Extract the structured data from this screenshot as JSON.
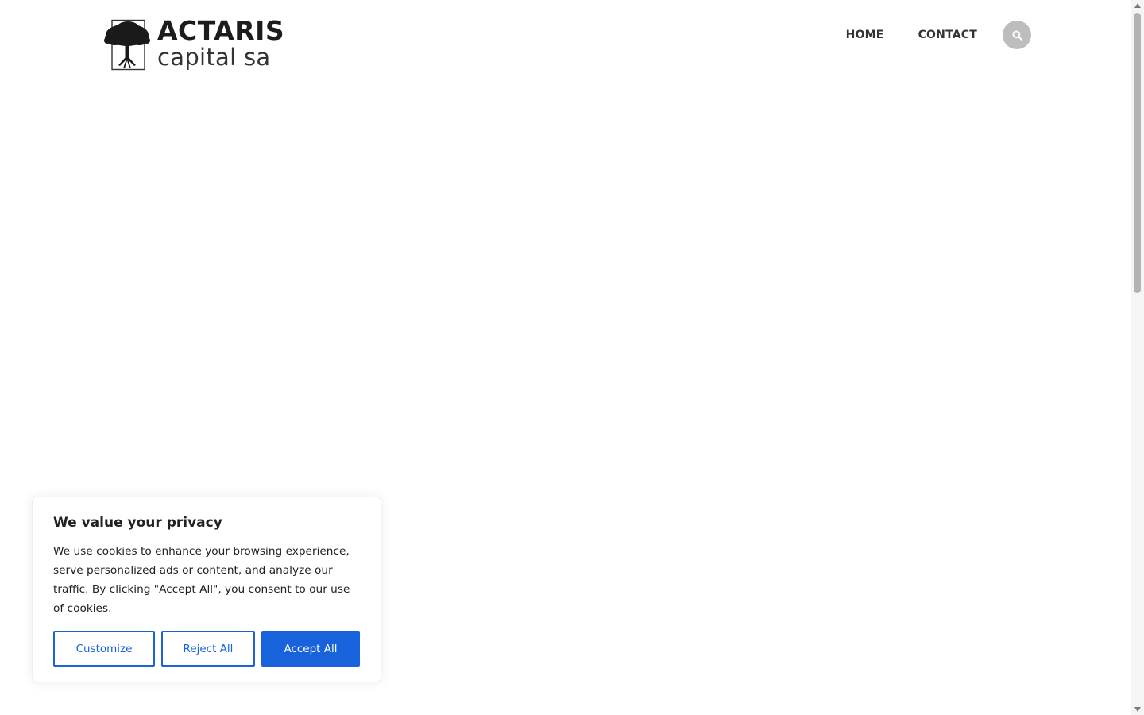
{
  "brand": {
    "name_line1": "ACTARIS",
    "name_line2": "capital sa"
  },
  "nav": {
    "items": [
      {
        "label": "HOME"
      },
      {
        "label": "CONTACT"
      }
    ],
    "search_icon": "search-icon"
  },
  "cookie_banner": {
    "title": "We value your privacy",
    "text": "We use cookies to enhance your browsing experience, serve personalized ads or content, and analyze our traffic. By clicking \"Accept All\", you consent to our use of cookies.",
    "customize_label": "Customize",
    "reject_label": "Reject All",
    "accept_label": "Accept All"
  },
  "colors": {
    "accent": "#1863dc",
    "search_bg": "#bdbdbd",
    "text": "#212121"
  }
}
